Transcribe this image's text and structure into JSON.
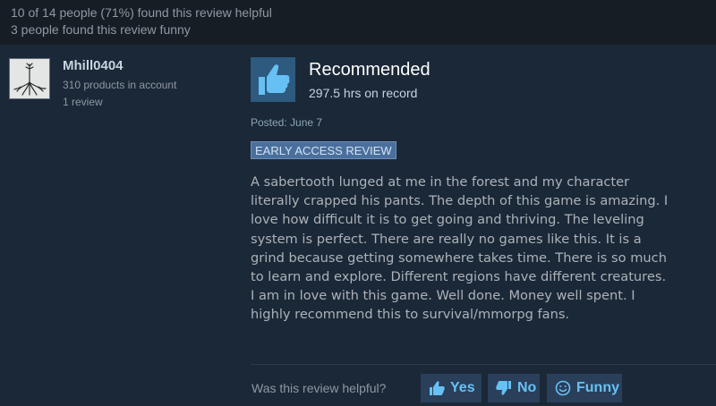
{
  "header": {
    "helpful_summary": "10 of 14 people (71%) found this review helpful",
    "funny_summary": "3 people found this review funny"
  },
  "author": {
    "username": "Mhill0404",
    "products": "310 products in account",
    "reviews": "1 review",
    "avatar_icon": "tree-roots-icon"
  },
  "review": {
    "verdict": "Recommended",
    "verdict_icon": "thumbs-up-icon",
    "hours": "297.5 hrs on record",
    "posted": "Posted: June 7",
    "badge": "EARLY ACCESS REVIEW",
    "text_lines": [
      "A sabertooth lunged at me in the forest and my character",
      "literally crapped his pants. The depth of this game is amazing. I",
      "love how difficult it is to get going and thriving. The leveling",
      "system is perfect. There are really no games like this. It is a",
      "grind because getting somewhere takes time. There is so much",
      "to learn and explore. Different regions have different creatures.",
      "I am in love with this game. Well done. Money well spent. I",
      "highly recommend this to survival/mmorpg fans."
    ]
  },
  "feedback": {
    "question": "Was this review helpful?",
    "yes_label": "Yes",
    "no_label": "No",
    "funny_label": "Funny"
  },
  "colors": {
    "background": "#1b2838",
    "header_bg": "#171d25",
    "accent": "#67c1f5",
    "button_bg": "#2a3f5a"
  }
}
